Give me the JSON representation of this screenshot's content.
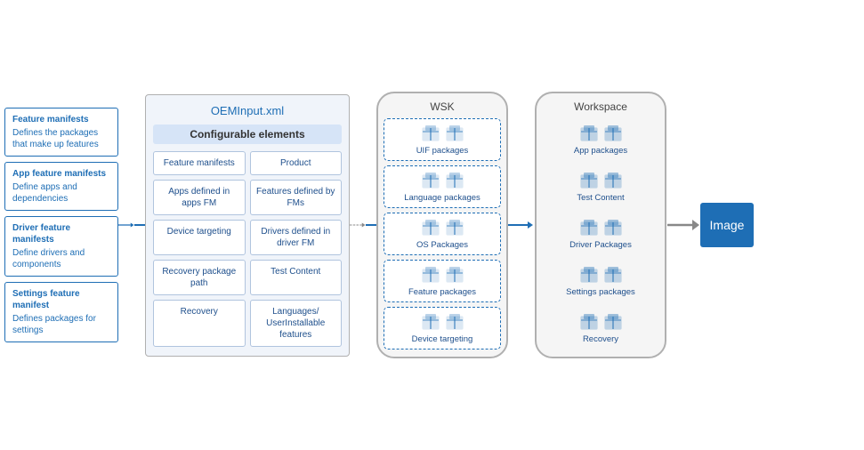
{
  "left_sidebar": {
    "cards": [
      {
        "id": "feature-manifests",
        "title": "Feature manifests",
        "desc": "Defines the packages that make up features"
      },
      {
        "id": "app-feature-manifests",
        "title": "App feature manifests",
        "desc": "Define apps and dependencies"
      },
      {
        "id": "driver-feature-manifests",
        "title": "Driver feature manifests",
        "desc": "Define drivers and components"
      },
      {
        "id": "settings-feature-manifest",
        "title": "Settings feature manifest",
        "desc": "Defines packages for settings"
      }
    ]
  },
  "center": {
    "title": "OEMInput.xml",
    "configLabel": "Configurable elements",
    "cells": [
      {
        "id": "feature-manifests-cell",
        "text": "Feature manifests"
      },
      {
        "id": "product-cell",
        "text": "Product"
      },
      {
        "id": "apps-defined-cell",
        "text": "Apps defined in apps FM"
      },
      {
        "id": "features-defined-cell",
        "text": "Features defined by FMs"
      },
      {
        "id": "device-targeting-cell",
        "text": "Device targeting"
      },
      {
        "id": "drivers-defined-cell",
        "text": "Drivers defined in driver FM"
      },
      {
        "id": "recovery-package-cell",
        "text": "Recovery package path"
      },
      {
        "id": "test-content-cell",
        "text": "Test Content"
      },
      {
        "id": "recovery-cell",
        "text": "Recovery"
      },
      {
        "id": "languages-cell",
        "text": "Languages/ UserInstallable features"
      }
    ]
  },
  "wsk": {
    "title": "WSK",
    "packages": [
      {
        "id": "uif-packages",
        "label": "UIF packages"
      },
      {
        "id": "language-packages",
        "label": "Language packages"
      },
      {
        "id": "os-packages",
        "label": "OS Packages"
      },
      {
        "id": "feature-packages",
        "label": "Feature packages"
      },
      {
        "id": "device-targeting-pkg",
        "label": "Device targeting"
      }
    ]
  },
  "workspace": {
    "title": "Workspace",
    "packages": [
      {
        "id": "app-packages",
        "label": "App packages"
      },
      {
        "id": "test-content-ws",
        "label": "Test Content"
      },
      {
        "id": "driver-packages",
        "label": "Driver Packages"
      },
      {
        "id": "settings-packages",
        "label": "Settings packages"
      },
      {
        "id": "recovery-ws",
        "label": "Recovery"
      }
    ]
  },
  "image_box": {
    "label": "Image"
  },
  "colors": {
    "blue": "#1e6eb5",
    "light_blue": "#d6e4f7",
    "border_gray": "#b0b0b0"
  }
}
